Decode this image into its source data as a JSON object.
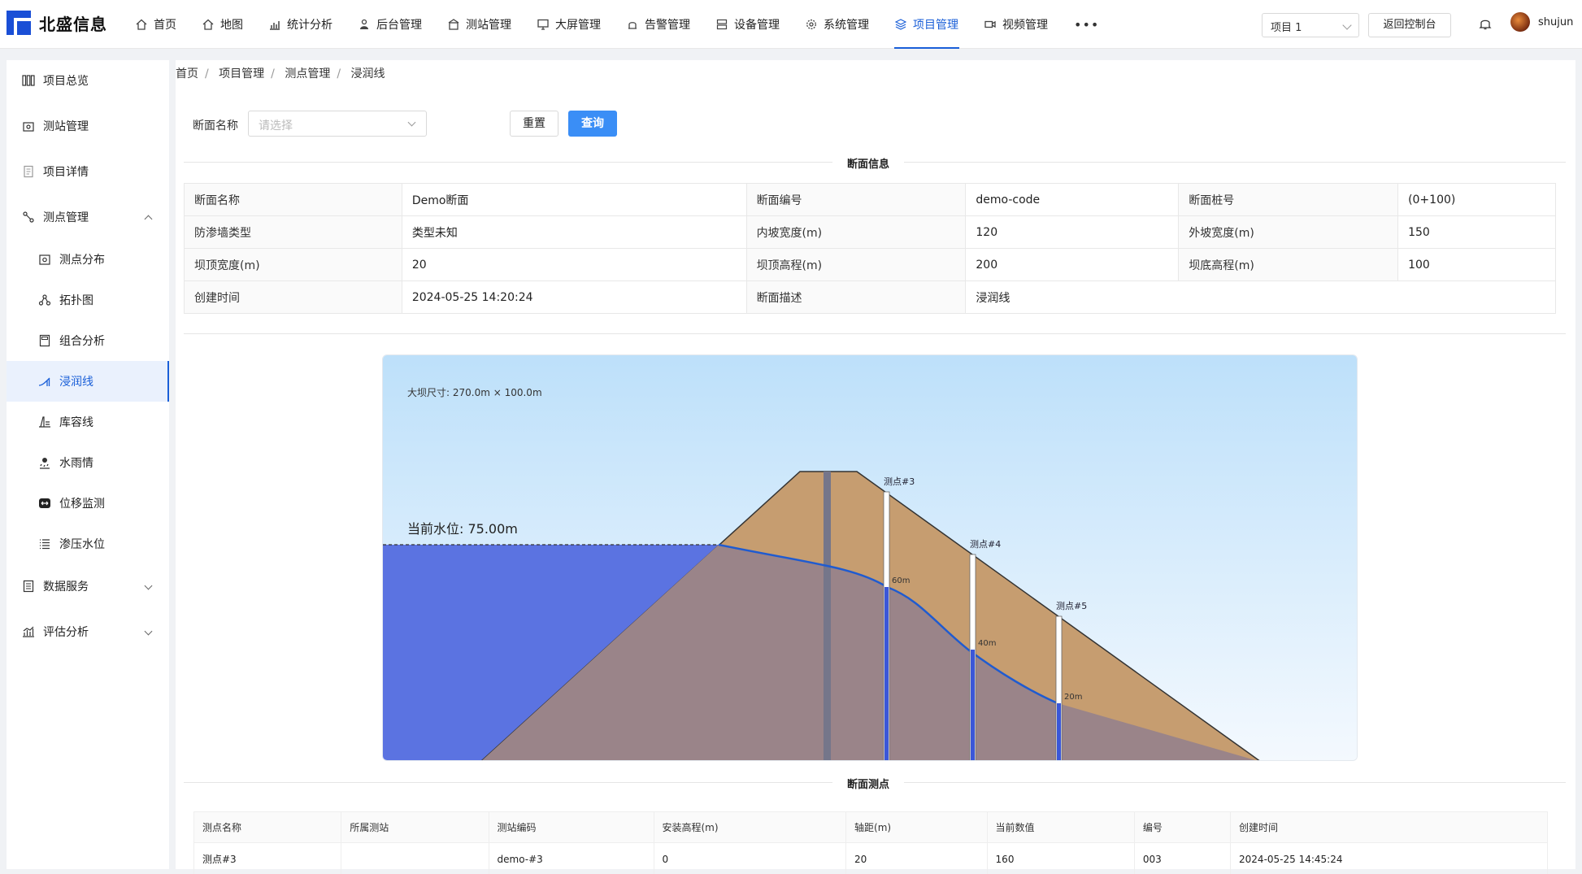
{
  "app": {
    "brand": "北盛信息"
  },
  "nav": [
    {
      "label": "首页",
      "icon": "home-icon"
    },
    {
      "label": "地图",
      "icon": "map-icon"
    },
    {
      "label": "统计分析",
      "icon": "chart-icon"
    },
    {
      "label": "后台管理",
      "icon": "admin-icon"
    },
    {
      "label": "测站管理",
      "icon": "station-icon"
    },
    {
      "label": "大屏管理",
      "icon": "screen-icon"
    },
    {
      "label": "告警管理",
      "icon": "alarm-icon"
    },
    {
      "label": "设备管理",
      "icon": "device-icon"
    },
    {
      "label": "系统管理",
      "icon": "gear-icon"
    },
    {
      "label": "项目管理",
      "icon": "layers-icon",
      "active": true
    },
    {
      "label": "视频管理",
      "icon": "video-icon"
    }
  ],
  "header": {
    "more": "•••",
    "project": "项目 1",
    "back": "返回控制台",
    "user": "shujun"
  },
  "sidebar": {
    "items": [
      {
        "label": "项目总览"
      },
      {
        "label": "测站管理"
      },
      {
        "label": "项目详情"
      },
      {
        "label": "测点管理"
      },
      {
        "label": "测点分布"
      },
      {
        "label": "拓扑图"
      },
      {
        "label": "组合分析"
      },
      {
        "label": "浸润线"
      },
      {
        "label": "库容线"
      },
      {
        "label": "水雨情"
      },
      {
        "label": "位移监测"
      },
      {
        "label": "渗压水位"
      },
      {
        "label": "数据服务"
      },
      {
        "label": "评估分析"
      }
    ]
  },
  "breadcrumb": [
    "首页",
    "项目管理",
    "测点管理",
    "浸润线"
  ],
  "filter": {
    "label": "断面名称",
    "placeholder": "请选择",
    "reset": "重置",
    "query": "查询"
  },
  "section_info": "断面信息",
  "info": {
    "rows": [
      [
        "断面名称",
        "Demo断面",
        "断面编号",
        "demo-code",
        "断面桩号",
        "(0+100)"
      ],
      [
        "防渗墙类型",
        "类型未知",
        "内坡宽度(m)",
        "120",
        "外坡宽度(m)",
        "150"
      ],
      [
        "坝顶宽度(m)",
        "20",
        "坝顶高程(m)",
        "200",
        "坝底高程(m)",
        "100"
      ],
      [
        "创建时间",
        "2024-05-25 14:20:24",
        "断面描述",
        "浸润线"
      ]
    ]
  },
  "dam": {
    "size_label": "大坝尺寸: 270.0m × 100.0m",
    "water_label": "当前水位: 75.00m",
    "points": [
      {
        "name": "测点#3",
        "value": "60m"
      },
      {
        "name": "测点#4",
        "value": "40m"
      },
      {
        "name": "测点#5",
        "value": "20m"
      }
    ]
  },
  "section_points": "断面测点",
  "points_table": {
    "headers": [
      "测点名称",
      "所属测站",
      "测站编码",
      "安装高程(m)",
      "轴距(m)",
      "当前数值",
      "编号",
      "创建时间"
    ],
    "rows": [
      [
        "测点#3",
        "",
        "demo-#3",
        "0",
        "20",
        "160",
        "003",
        "2024-05-25 14:45:24"
      ]
    ]
  }
}
